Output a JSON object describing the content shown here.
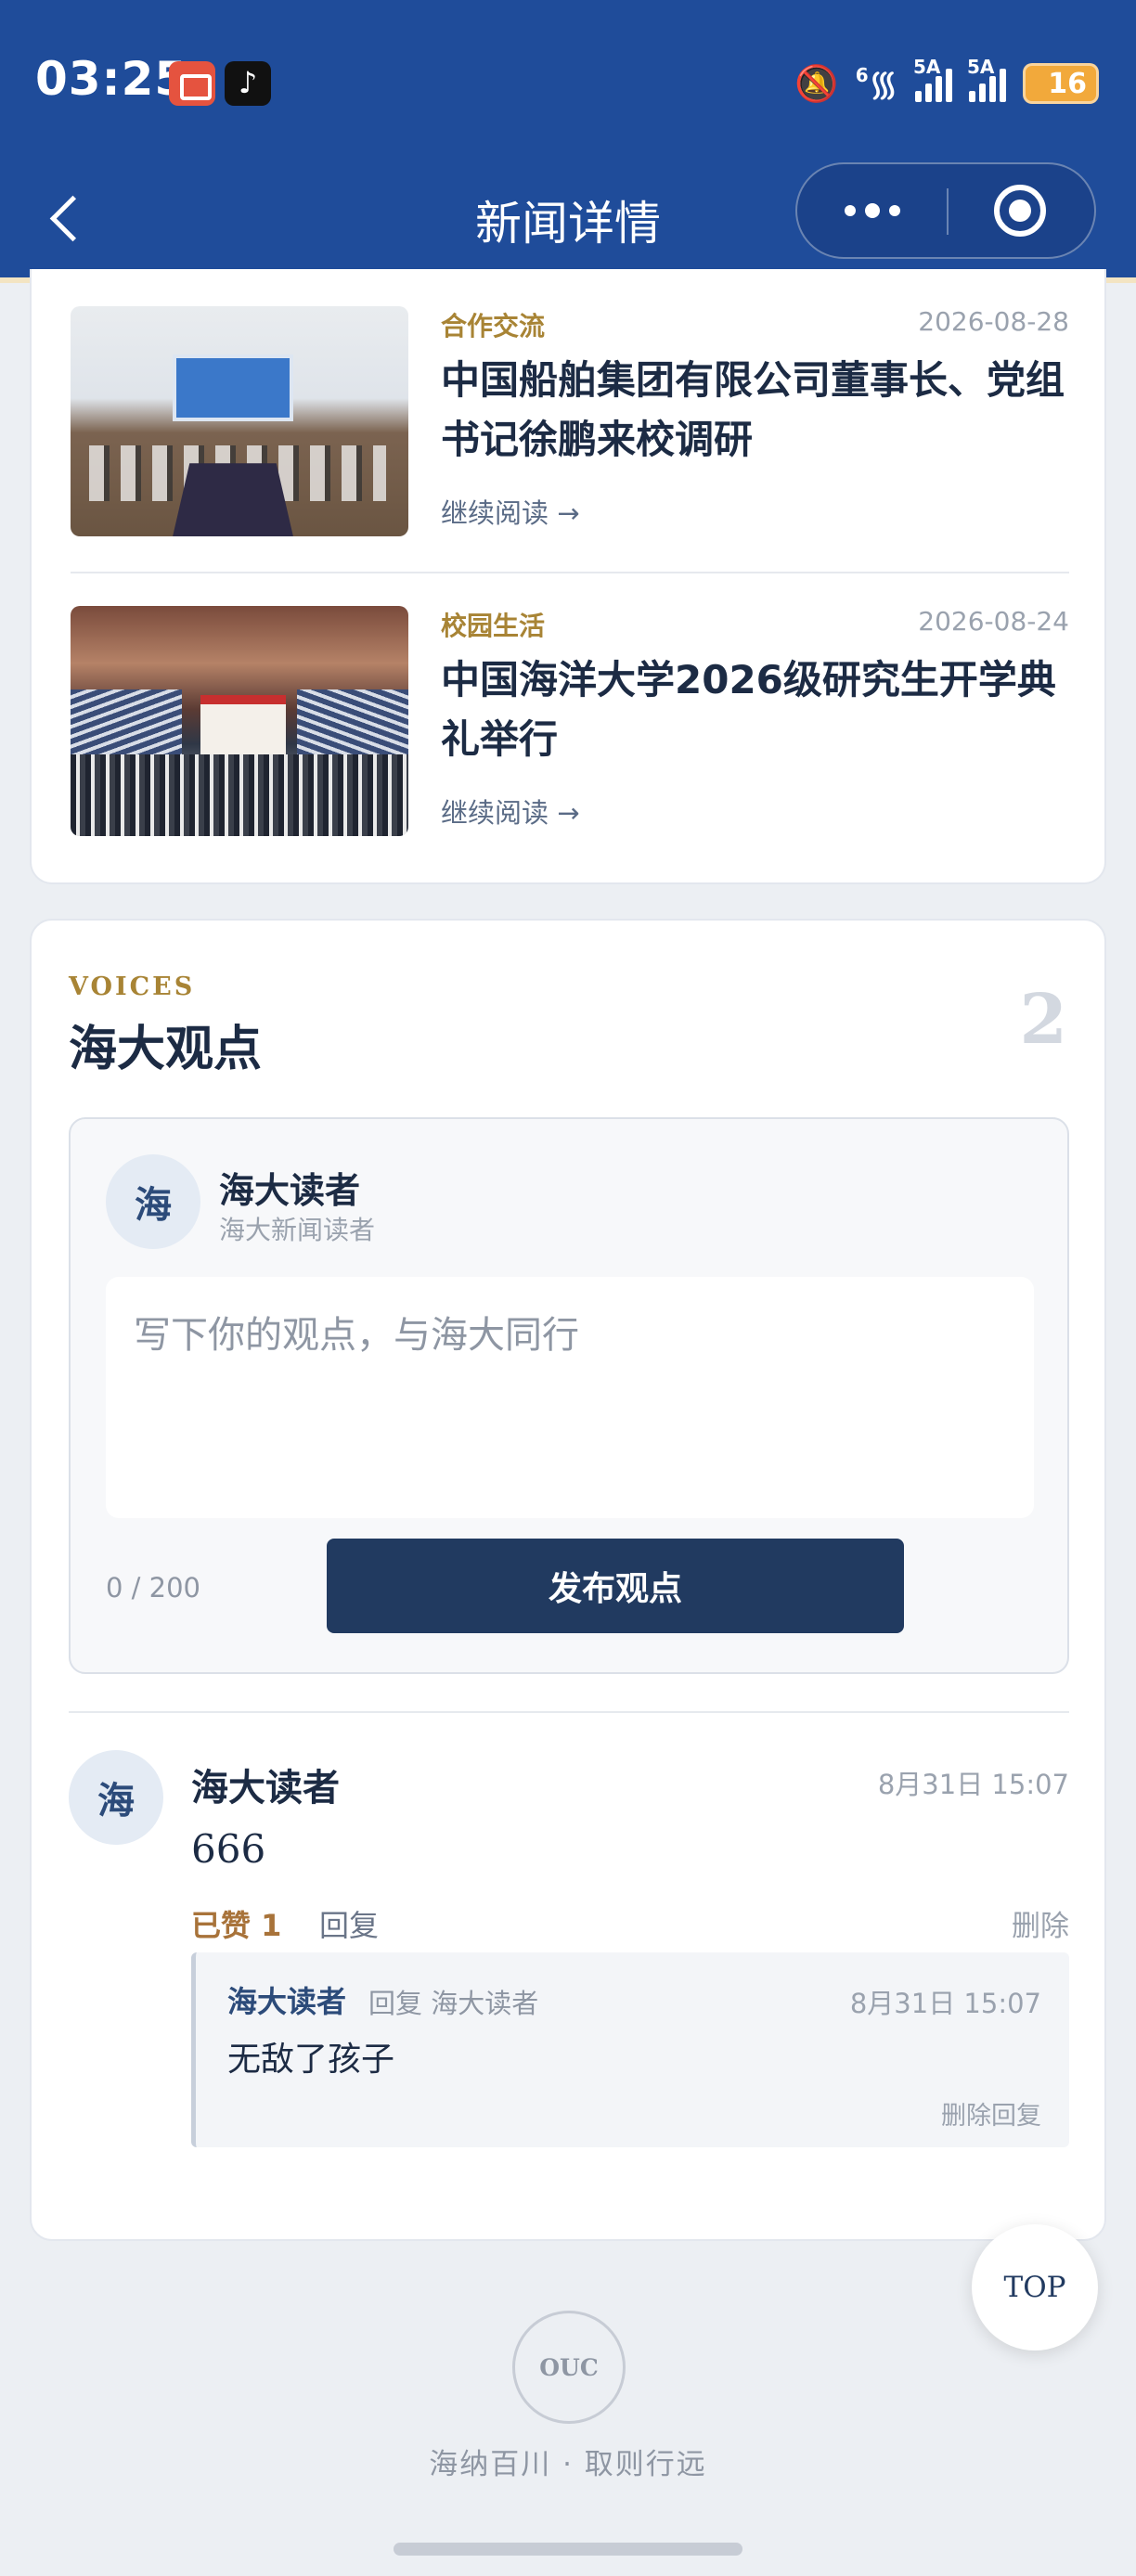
{
  "status_bar": {
    "time": "03:25",
    "network_1": "6",
    "network_2": "5A",
    "network_3": "5A",
    "battery": "16"
  },
  "nav": {
    "title": "新闻详情"
  },
  "news": [
    {
      "category": "合作交流",
      "date": "2026-08-28",
      "title": "中国船舶集团有限公司董事长、党组书记徐鹏来校调研",
      "more": "继续阅读 →"
    },
    {
      "category": "校园生活",
      "date": "2026-08-24",
      "title": "中国海洋大学2026级研究生开学典礼举行",
      "more": "继续阅读 →"
    }
  ],
  "voices": {
    "eyebrow": "VOICES",
    "title": "海大观点",
    "count": "2",
    "compose": {
      "avatar": "海",
      "name": "海大读者",
      "subtitle": "海大新闻读者",
      "placeholder": "写下你的观点，与海大同行",
      "counter": "0 / 200",
      "submit": "发布观点"
    },
    "comment": {
      "avatar": "海",
      "name": "海大读者",
      "time": "8月31日 15:07",
      "text": "666",
      "like": "已赞 1",
      "reply": "回复",
      "delete": "删除",
      "reply_item": {
        "name": "海大读者",
        "reply_to": "回复 海大读者",
        "time": "8月31日 15:07",
        "text": "无敌了孩子",
        "delete": "删除回复"
      }
    }
  },
  "top_button": "TOP",
  "footer": {
    "logo": "OUC",
    "motto": "海纳百川 · 取则行远"
  }
}
